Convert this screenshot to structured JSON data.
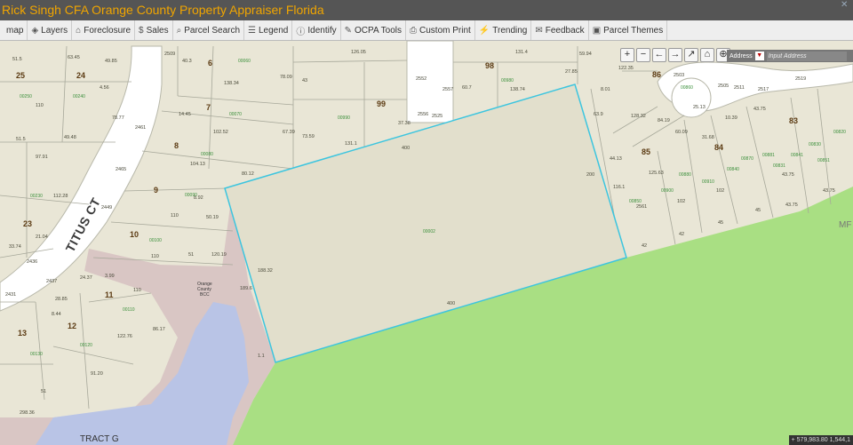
{
  "title": "Rick Singh CFA Orange County Property Appraiser Florida",
  "toolbar": [
    {
      "icon": "map-icon",
      "glyph": "",
      "label": "map"
    },
    {
      "icon": "layers-icon",
      "glyph": "◈",
      "label": "Layers"
    },
    {
      "icon": "foreclosure-icon",
      "glyph": "⌂",
      "label": "Foreclosure"
    },
    {
      "icon": "dollar-icon",
      "glyph": "$",
      "label": "Sales"
    },
    {
      "icon": "search-icon",
      "glyph": "⌕",
      "label": "Parcel Search"
    },
    {
      "icon": "legend-icon",
      "glyph": "☰",
      "label": "Legend"
    },
    {
      "icon": "info-icon",
      "glyph": "ⓘ",
      "label": "Identify"
    },
    {
      "icon": "wrench-icon",
      "glyph": "✎",
      "label": "OCPA Tools"
    },
    {
      "icon": "print-icon",
      "glyph": "⎙",
      "label": "Custom Print"
    },
    {
      "icon": "trending-icon",
      "glyph": "⚡",
      "label": "Trending"
    },
    {
      "icon": "feedback-icon",
      "glyph": "✉",
      "label": "Feedback"
    },
    {
      "icon": "themes-icon",
      "glyph": "▣",
      "label": "Parcel Themes"
    }
  ],
  "search": {
    "label": "Address",
    "placeholder": "Input Address"
  },
  "coords": "579,983.80 1,544,1",
  "map": {
    "road_label": "TITUS CT",
    "tract_label": "TRACT G",
    "owner_label_1": "Orange",
    "owner_label_2": "County",
    "owner_label_3": "BCC",
    "mf_label": "MF",
    "lots": {
      "l25": "25",
      "l24": "24",
      "l6": "6",
      "l7": "7",
      "l8": "8",
      "l9": "9",
      "l10": "10",
      "l11": "11",
      "l12": "12",
      "l13": "13",
      "l23": "23",
      "l98": "98",
      "l99": "99",
      "l86": "86",
      "l85": "85",
      "l84": "84",
      "l83": "83"
    },
    "dims": {
      "d1": "51.5",
      "d2": "63.45",
      "d3": "49.85",
      "d4": "2509",
      "d5": "40.3",
      "d6": "126.05",
      "d7": "131.4",
      "d8": "59.94",
      "d9": "122.35",
      "d10": "4.56",
      "d11": "78.77",
      "d12": "138.34",
      "d13": "78.09",
      "d14": "43",
      "d15": "14.45",
      "d16": "102.52",
      "d17": "67.39",
      "d18": "73.59",
      "d19": "131.1",
      "d20": "37.38",
      "d21": "2556",
      "d22": "2525",
      "d23": "2552",
      "d24": "2557",
      "d25": "60.7",
      "d26": "138.74",
      "d27": "27.85",
      "d28": "8.01",
      "d29": "128.32",
      "d30": "84.19",
      "d31": "60.09",
      "d32": "63.9",
      "d33": "25.13",
      "d34": "31.68",
      "d35": "10.39",
      "d36": "43.75",
      "d37": "2517",
      "d38": "2519",
      "d39": "2511",
      "d40": "2503",
      "d41": "2505",
      "d42": "51.5",
      "d43": "49.48",
      "d44": "97.91",
      "d45": "104.13",
      "d46": "80.12",
      "d47": "8.92",
      "d48": "110",
      "d49": "50.19",
      "d50": "2461",
      "d51": "2465",
      "d52": "2449",
      "d53": "112.28",
      "d54": "21.04",
      "d55": "33.74",
      "d56": "2436",
      "d57": "2431",
      "d58": "2437",
      "d59": "24.37",
      "d60": "3.99",
      "d61": "110",
      "d62": "120.19",
      "d63": "51",
      "d64": "110",
      "d65": "28.85",
      "d66": "8.44",
      "d67": "122.76",
      "d68": "86.17",
      "d69": "91.20",
      "d70": "51",
      "d71": "298.36",
      "d72": "1.1",
      "d73": "189.6",
      "d74": "188.32",
      "d75": "400",
      "d76": "400",
      "d77": "200",
      "d78": "44.13",
      "d79": "116.1",
      "d80": "2561",
      "d81": "125.63",
      "d82": "102",
      "d83": "102",
      "d84": "45",
      "d85": "42",
      "d86": "42",
      "d87": "45",
      "d88": "43.75",
      "d89": "43.75",
      "d90": "43.75",
      "d91": "110"
    },
    "pids": {
      "p1": "00250",
      "p2": "00240",
      "p3": "00060",
      "p4": "00070",
      "p5": "00080",
      "p6": "00090",
      "p7": "00100",
      "p8": "00110",
      "p9": "00120",
      "p10": "00130",
      "p11": "00230",
      "p12": "00980",
      "p13": "00990",
      "p14": "00002",
      "p15": "00850",
      "p16": "00840",
      "p17": "00830",
      "p18": "00860",
      "p19": "00900",
      "p20": "00910",
      "p21": "00880",
      "p22": "00870",
      "p23": "00881",
      "p24": "00820",
      "p25": "00831",
      "p26": "00841",
      "p27": "00851"
    }
  },
  "colors": {
    "title_text": "#f0a500",
    "titlebar": "#555555",
    "parcel": "#e9e6d6",
    "parcel_line": "#a7a89a",
    "road": "#ffffff",
    "green": "#a9df83",
    "water": "#b9c4e6",
    "pink": "#d8c2c2",
    "selection": "#3cc5df"
  }
}
